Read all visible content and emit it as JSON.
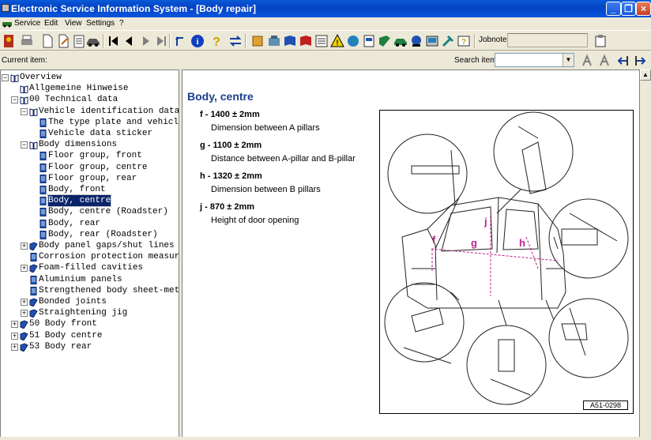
{
  "window": {
    "title": "Electronic Service Information System - [Body repair]"
  },
  "menu": {
    "items": [
      "Service",
      "Edit",
      "View",
      "Settings",
      "?"
    ]
  },
  "toolbar": {
    "jobnote_label": "Jobnote:",
    "jobnote_value": "",
    "icons": [
      "exit-icon",
      "print-icon",
      "new-page-icon",
      "edit-icon",
      "notepad-icon",
      "car-icon",
      "first-icon",
      "previous-icon",
      "next-icon",
      "last-icon",
      "up-level-icon",
      "info-icon",
      "help-icon",
      "swap-icon",
      "module-icon",
      "engine-icon",
      "book-icon",
      "book-red-icon",
      "list-icon",
      "warning-icon",
      "globe-icon",
      "document-icon",
      "green-book-icon",
      "vehicle-icon",
      "alert-icon",
      "diagnosis-icon",
      "tools-icon",
      "hint-icon"
    ]
  },
  "current_item": {
    "label": "Current item:",
    "value": ""
  },
  "search": {
    "label": "Search item:",
    "value": ""
  },
  "tree": {
    "items": [
      {
        "label": "Overview",
        "level": 0,
        "expander": "-",
        "icon": "open"
      },
      {
        "label": "Allgemeine Hinweise",
        "level": 1,
        "expander": "",
        "icon": "open"
      },
      {
        "label": "00 Technical data",
        "level": 1,
        "expander": "-",
        "icon": "open"
      },
      {
        "label": "Vehicle identification data",
        "level": 2,
        "expander": "-",
        "icon": "open"
      },
      {
        "label": "The type plate and vehicle",
        "level": 3,
        "expander": "",
        "icon": "page"
      },
      {
        "label": "Vehicle data sticker",
        "level": 3,
        "expander": "",
        "icon": "page"
      },
      {
        "label": "Body dimensions",
        "level": 2,
        "expander": "-",
        "icon": "open"
      },
      {
        "label": "Floor group, front",
        "level": 3,
        "expander": "",
        "icon": "page"
      },
      {
        "label": "Floor group, centre",
        "level": 3,
        "expander": "",
        "icon": "page"
      },
      {
        "label": "Floor group, rear",
        "level": 3,
        "expander": "",
        "icon": "page"
      },
      {
        "label": "Body, front",
        "level": 3,
        "expander": "",
        "icon": "page"
      },
      {
        "label": "Body, centre",
        "level": 3,
        "expander": "",
        "icon": "page",
        "selected": true
      },
      {
        "label": "Body, centre (Roadster)",
        "level": 3,
        "expander": "",
        "icon": "page"
      },
      {
        "label": "Body, rear",
        "level": 3,
        "expander": "",
        "icon": "page"
      },
      {
        "label": "Body, rear (Roadster)",
        "level": 3,
        "expander": "",
        "icon": "page"
      },
      {
        "label": "Body panel gaps/shut lines",
        "level": 2,
        "expander": "+",
        "icon": "closed"
      },
      {
        "label": "Corrosion protection measur",
        "level": 2,
        "expander": "",
        "icon": "page"
      },
      {
        "label": "Foam-filled cavities",
        "level": 2,
        "expander": "+",
        "icon": "closed"
      },
      {
        "label": "Aluminium panels",
        "level": 2,
        "expander": "",
        "icon": "page"
      },
      {
        "label": "Strengthened body sheet-met",
        "level": 2,
        "expander": "",
        "icon": "page"
      },
      {
        "label": "Bonded joints",
        "level": 2,
        "expander": "+",
        "icon": "closed"
      },
      {
        "label": "Straightening jig",
        "level": 2,
        "expander": "+",
        "icon": "closed"
      },
      {
        "label": "50 Body front",
        "level": 1,
        "expander": "+",
        "icon": "closed"
      },
      {
        "label": "51 Body centre",
        "level": 1,
        "expander": "+",
        "icon": "closed"
      },
      {
        "label": "53 Body rear",
        "level": 1,
        "expander": "+",
        "icon": "closed"
      }
    ]
  },
  "content": {
    "title": "Body, centre",
    "dimensions": [
      {
        "heading": "f - 1400 ± 2mm",
        "description": "Dimension between A pillars"
      },
      {
        "heading": "g - 1100 ± 2mm",
        "description": "Distance between A-pillar and B-pillar"
      },
      {
        "heading": "h - 1320 ± 2mm",
        "description": "Dimension between B pillars"
      },
      {
        "heading": "j - 870 ± 2mm",
        "description": "Height of door opening"
      }
    ],
    "figure": {
      "code": "A51-0298",
      "letters": [
        "f",
        "g",
        "j",
        "h"
      ],
      "accent": "#c0208c"
    }
  },
  "colors": {
    "titlebar": "#0343c4",
    "selection": "#0a246a",
    "heading": "#1a3e8c"
  }
}
